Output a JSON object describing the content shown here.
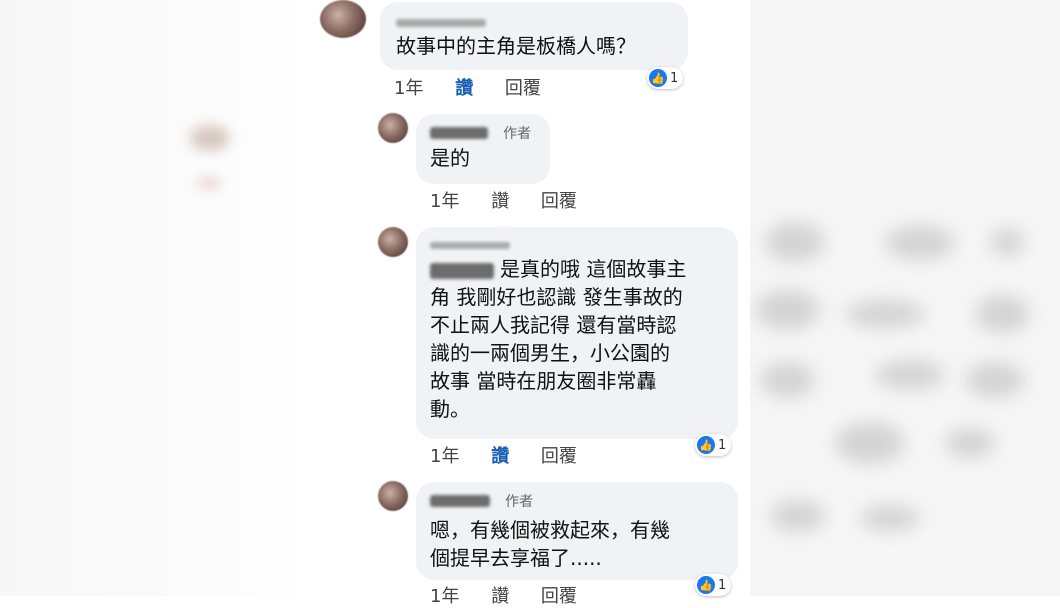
{
  "comments": [
    {
      "text": "故事中的主角是板橋人嗎？",
      "time": "1年",
      "like": "讚",
      "reply": "回覆",
      "reactions": "1"
    },
    {
      "author_tag": "作者",
      "text": "是的",
      "time": "1年",
      "like": "讚",
      "reply": "回覆"
    },
    {
      "lines": [
        "是真的哦 這個故事主",
        "角 我剛好也認識 發生事故的",
        "不止兩人我記得 還有當時認",
        "識的一兩個男生，小公園的",
        "故事 當時在朋友圈非常轟",
        "動。"
      ],
      "time": "1年",
      "like": "讚",
      "reply": "回覆",
      "reactions": "1"
    },
    {
      "author_tag": "作者",
      "lines": [
        "嗯，有幾個被救起來，有幾",
        "個提早去享福了....."
      ],
      "time": "1年",
      "like": "讚",
      "reply": "回覆",
      "reactions": "1"
    }
  ],
  "colors": {
    "bubble": "#f0f2f5",
    "like_active": "#1a5fb4",
    "reaction_blue": "#1877f2"
  },
  "icons": [
    "like-thumb-icon"
  ]
}
